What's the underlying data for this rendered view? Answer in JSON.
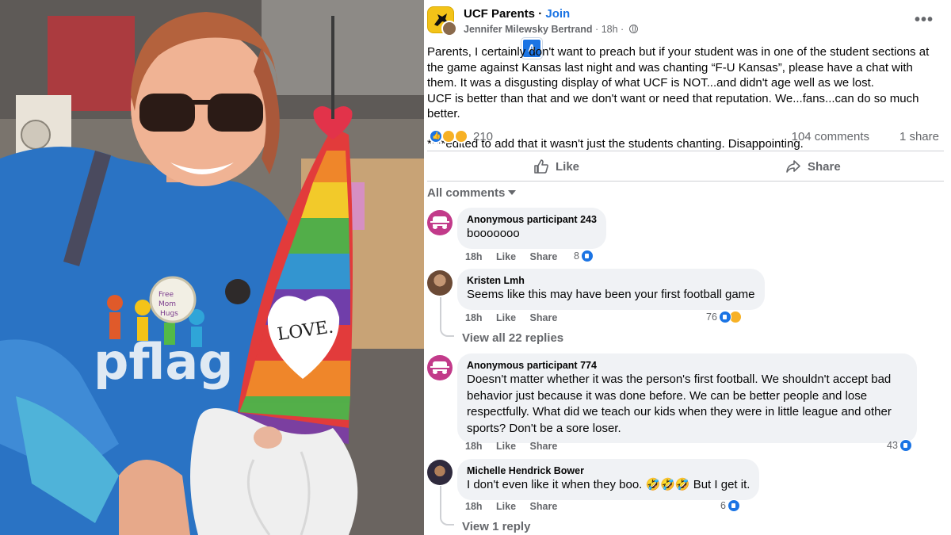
{
  "photo": {
    "pin_text": "Free Mom Hugs",
    "gnome_heart_text": "LOVE.",
    "shirt_text": "pflag"
  },
  "post": {
    "group_name": "UCF Parents",
    "join_label": "Join",
    "author": "Jennifer Milewsky Bertrand",
    "time": "18h",
    "body": "Parents, I certainly don't want to preach but if your student was in one of the student sections at the game against Kansas last night and was chanting “F-U Kansas”, please  have a chat with them. It was a disgusting display of what UCF is NOT...and didn't age well as we lost.",
    "body_2": "UCF is better than that and we don't want or need that reputation. We...fans...can do so much better.",
    "edit_note": "****edited to add that it wasn't just the students chanting. Disappointing.",
    "reaction_count": "210",
    "comments_count": "104 comments",
    "shares_count": "1 share",
    "translate_icon": "translate-icon",
    "accent_color": "#1b74e4"
  },
  "actions": {
    "like": "Like",
    "share": "Share"
  },
  "comments_filter": "All comments",
  "comments": [
    {
      "author": "Anonymous participant 243",
      "text": "booooooo",
      "time": "18h",
      "like": "Like",
      "share": "Share",
      "reactions": "8"
    },
    {
      "author": "Kristen Lmh",
      "text": "Seems like this may have been your first football game",
      "time": "18h",
      "like": "Like",
      "share": "Share",
      "reactions": "76",
      "view_replies": "View all 22 replies"
    },
    {
      "author": "Anonymous participant 774",
      "text": "Doesn't matter whether it was the person's first football. We shouldn't accept bad behavior just because it was done before. We can be better people and lose respectfully. What did we teach our kids when they were in little league and other sports? Don't be a sore loser.",
      "time": "18h",
      "like": "Like",
      "share": "Share",
      "reactions": "43"
    },
    {
      "author": "Michelle Hendrick Bower",
      "text": "I don't even like it when they boo. 🤣🤣🤣 But I get it.",
      "time": "18h",
      "like": "Like",
      "share": "Share",
      "reactions": "6",
      "view_replies": "View 1 reply"
    }
  ]
}
